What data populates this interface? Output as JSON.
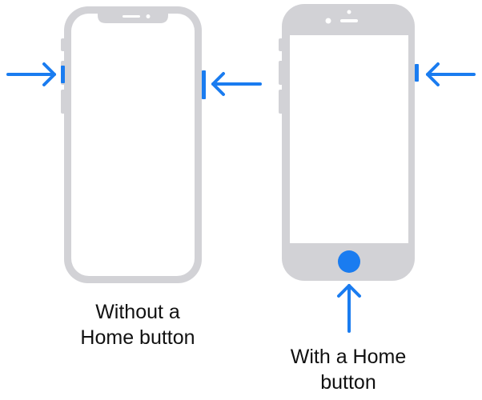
{
  "colors": {
    "accent": "#1a7cf0",
    "device_frame": "#d2d2d6",
    "screen": "#ffffff",
    "text": "#111111"
  },
  "devices": [
    {
      "id": "without-home-button",
      "caption_lines": [
        "Without a",
        "Home button"
      ]
    },
    {
      "id": "with-home-button",
      "caption_lines": [
        "With a Home",
        "button"
      ]
    }
  ]
}
